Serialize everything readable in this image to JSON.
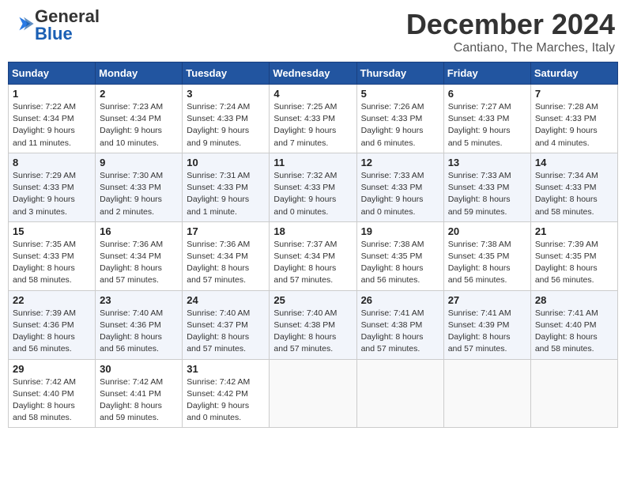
{
  "header": {
    "logo_line1": "General",
    "logo_line2": "Blue",
    "month": "December 2024",
    "location": "Cantiano, The Marches, Italy"
  },
  "weekdays": [
    "Sunday",
    "Monday",
    "Tuesday",
    "Wednesday",
    "Thursday",
    "Friday",
    "Saturday"
  ],
  "weeks": [
    [
      {
        "day": "1",
        "sunrise": "Sunrise: 7:22 AM",
        "sunset": "Sunset: 4:34 PM",
        "daylight": "Daylight: 9 hours and 11 minutes."
      },
      {
        "day": "2",
        "sunrise": "Sunrise: 7:23 AM",
        "sunset": "Sunset: 4:34 PM",
        "daylight": "Daylight: 9 hours and 10 minutes."
      },
      {
        "day": "3",
        "sunrise": "Sunrise: 7:24 AM",
        "sunset": "Sunset: 4:33 PM",
        "daylight": "Daylight: 9 hours and 9 minutes."
      },
      {
        "day": "4",
        "sunrise": "Sunrise: 7:25 AM",
        "sunset": "Sunset: 4:33 PM",
        "daylight": "Daylight: 9 hours and 7 minutes."
      },
      {
        "day": "5",
        "sunrise": "Sunrise: 7:26 AM",
        "sunset": "Sunset: 4:33 PM",
        "daylight": "Daylight: 9 hours and 6 minutes."
      },
      {
        "day": "6",
        "sunrise": "Sunrise: 7:27 AM",
        "sunset": "Sunset: 4:33 PM",
        "daylight": "Daylight: 9 hours and 5 minutes."
      },
      {
        "day": "7",
        "sunrise": "Sunrise: 7:28 AM",
        "sunset": "Sunset: 4:33 PM",
        "daylight": "Daylight: 9 hours and 4 minutes."
      }
    ],
    [
      {
        "day": "8",
        "sunrise": "Sunrise: 7:29 AM",
        "sunset": "Sunset: 4:33 PM",
        "daylight": "Daylight: 9 hours and 3 minutes."
      },
      {
        "day": "9",
        "sunrise": "Sunrise: 7:30 AM",
        "sunset": "Sunset: 4:33 PM",
        "daylight": "Daylight: 9 hours and 2 minutes."
      },
      {
        "day": "10",
        "sunrise": "Sunrise: 7:31 AM",
        "sunset": "Sunset: 4:33 PM",
        "daylight": "Daylight: 9 hours and 1 minute."
      },
      {
        "day": "11",
        "sunrise": "Sunrise: 7:32 AM",
        "sunset": "Sunset: 4:33 PM",
        "daylight": "Daylight: 9 hours and 0 minutes."
      },
      {
        "day": "12",
        "sunrise": "Sunrise: 7:33 AM",
        "sunset": "Sunset: 4:33 PM",
        "daylight": "Daylight: 9 hours and 0 minutes."
      },
      {
        "day": "13",
        "sunrise": "Sunrise: 7:33 AM",
        "sunset": "Sunset: 4:33 PM",
        "daylight": "Daylight: 8 hours and 59 minutes."
      },
      {
        "day": "14",
        "sunrise": "Sunrise: 7:34 AM",
        "sunset": "Sunset: 4:33 PM",
        "daylight": "Daylight: 8 hours and 58 minutes."
      }
    ],
    [
      {
        "day": "15",
        "sunrise": "Sunrise: 7:35 AM",
        "sunset": "Sunset: 4:33 PM",
        "daylight": "Daylight: 8 hours and 58 minutes."
      },
      {
        "day": "16",
        "sunrise": "Sunrise: 7:36 AM",
        "sunset": "Sunset: 4:34 PM",
        "daylight": "Daylight: 8 hours and 57 minutes."
      },
      {
        "day": "17",
        "sunrise": "Sunrise: 7:36 AM",
        "sunset": "Sunset: 4:34 PM",
        "daylight": "Daylight: 8 hours and 57 minutes."
      },
      {
        "day": "18",
        "sunrise": "Sunrise: 7:37 AM",
        "sunset": "Sunset: 4:34 PM",
        "daylight": "Daylight: 8 hours and 57 minutes."
      },
      {
        "day": "19",
        "sunrise": "Sunrise: 7:38 AM",
        "sunset": "Sunset: 4:35 PM",
        "daylight": "Daylight: 8 hours and 56 minutes."
      },
      {
        "day": "20",
        "sunrise": "Sunrise: 7:38 AM",
        "sunset": "Sunset: 4:35 PM",
        "daylight": "Daylight: 8 hours and 56 minutes."
      },
      {
        "day": "21",
        "sunrise": "Sunrise: 7:39 AM",
        "sunset": "Sunset: 4:35 PM",
        "daylight": "Daylight: 8 hours and 56 minutes."
      }
    ],
    [
      {
        "day": "22",
        "sunrise": "Sunrise: 7:39 AM",
        "sunset": "Sunset: 4:36 PM",
        "daylight": "Daylight: 8 hours and 56 minutes."
      },
      {
        "day": "23",
        "sunrise": "Sunrise: 7:40 AM",
        "sunset": "Sunset: 4:36 PM",
        "daylight": "Daylight: 8 hours and 56 minutes."
      },
      {
        "day": "24",
        "sunrise": "Sunrise: 7:40 AM",
        "sunset": "Sunset: 4:37 PM",
        "daylight": "Daylight: 8 hours and 57 minutes."
      },
      {
        "day": "25",
        "sunrise": "Sunrise: 7:40 AM",
        "sunset": "Sunset: 4:38 PM",
        "daylight": "Daylight: 8 hours and 57 minutes."
      },
      {
        "day": "26",
        "sunrise": "Sunrise: 7:41 AM",
        "sunset": "Sunset: 4:38 PM",
        "daylight": "Daylight: 8 hours and 57 minutes."
      },
      {
        "day": "27",
        "sunrise": "Sunrise: 7:41 AM",
        "sunset": "Sunset: 4:39 PM",
        "daylight": "Daylight: 8 hours and 57 minutes."
      },
      {
        "day": "28",
        "sunrise": "Sunrise: 7:41 AM",
        "sunset": "Sunset: 4:40 PM",
        "daylight": "Daylight: 8 hours and 58 minutes."
      }
    ],
    [
      {
        "day": "29",
        "sunrise": "Sunrise: 7:42 AM",
        "sunset": "Sunset: 4:40 PM",
        "daylight": "Daylight: 8 hours and 58 minutes."
      },
      {
        "day": "30",
        "sunrise": "Sunrise: 7:42 AM",
        "sunset": "Sunset: 4:41 PM",
        "daylight": "Daylight: 8 hours and 59 minutes."
      },
      {
        "day": "31",
        "sunrise": "Sunrise: 7:42 AM",
        "sunset": "Sunset: 4:42 PM",
        "daylight": "Daylight: 9 hours and 0 minutes."
      },
      null,
      null,
      null,
      null
    ]
  ]
}
